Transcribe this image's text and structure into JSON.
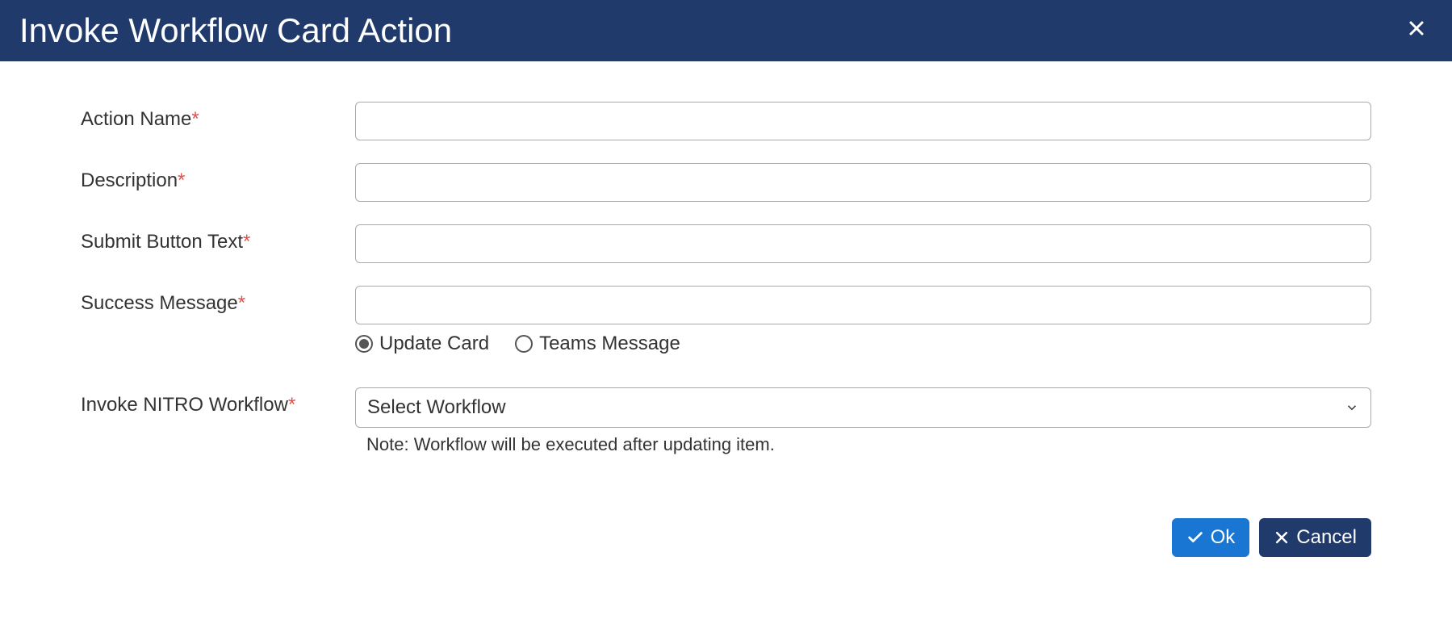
{
  "header": {
    "title": "Invoke Workflow Card Action"
  },
  "form": {
    "action_name": {
      "label": "Action Name",
      "value": ""
    },
    "description": {
      "label": "Description",
      "value": ""
    },
    "submit_button_text": {
      "label": "Submit Button Text",
      "value": ""
    },
    "success_message": {
      "label": "Success Message",
      "value": ""
    },
    "message_type": {
      "update_card": "Update Card",
      "teams_message": "Teams Message"
    },
    "invoke_workflow": {
      "label": "Invoke NITRO Workflow",
      "placeholder": "Select Workflow",
      "note": "Note: Workflow will be executed after updating item."
    }
  },
  "footer": {
    "ok": "Ok",
    "cancel": "Cancel"
  }
}
